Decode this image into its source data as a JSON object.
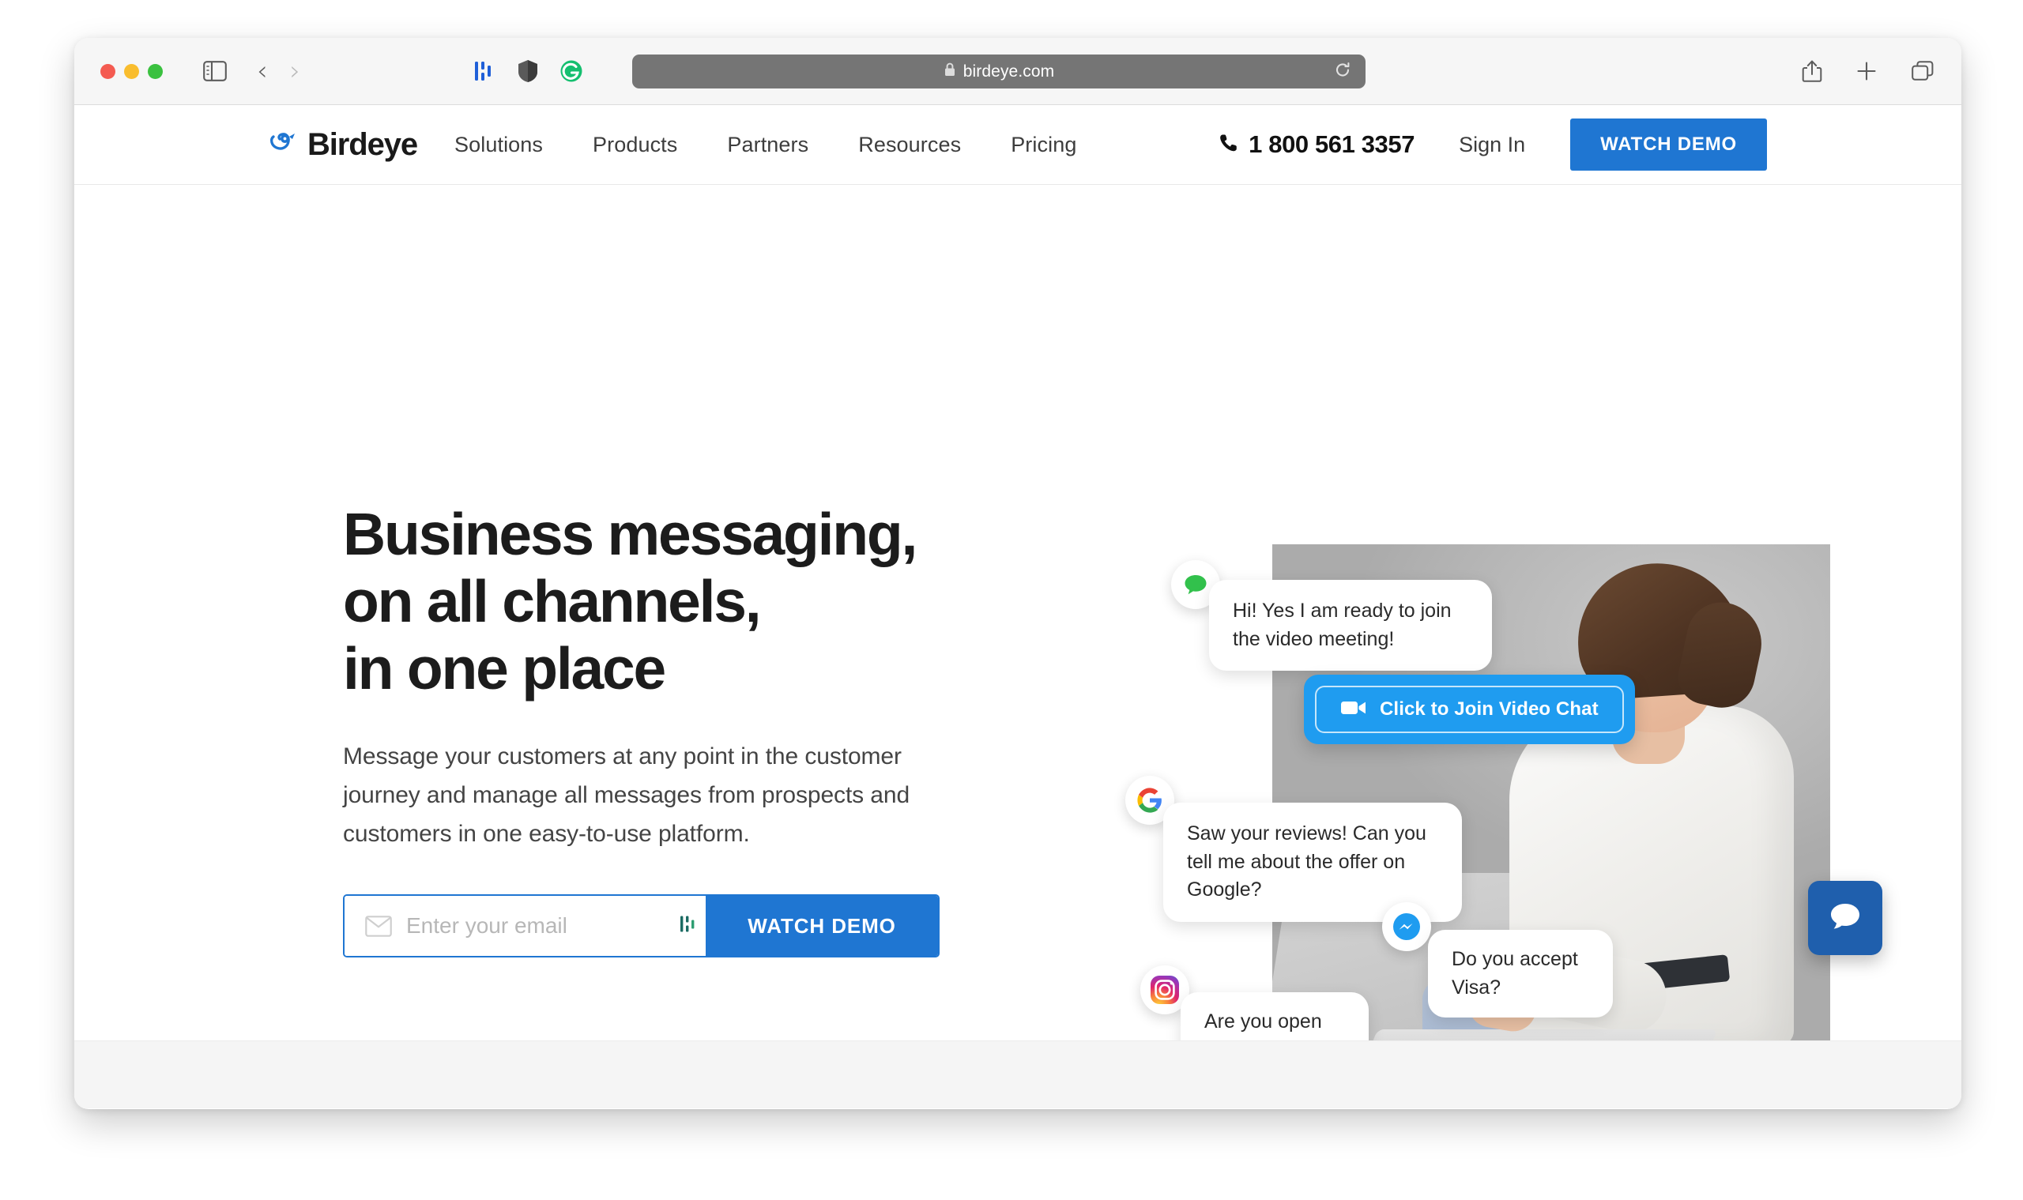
{
  "browser": {
    "url": "birdeye.com",
    "lock_icon": "lock-icon",
    "sidebar_icon": "sidebar-toggle-icon",
    "back_icon": "back-arrow-icon",
    "forward_icon": "forward-arrow-icon",
    "extensions": [
      "onepassword-icon",
      "shield-privacy-icon",
      "grammarly-icon"
    ],
    "reload_icon": "reload-icon",
    "share_icon": "share-icon",
    "new_tab_icon": "plus-icon",
    "tab_overview_icon": "tab-overview-icon"
  },
  "nav": {
    "brand": "Birdeye",
    "links": [
      "Solutions",
      "Products",
      "Partners",
      "Resources",
      "Pricing"
    ],
    "phone": "1 800 561 3357",
    "phone_icon": "phone-icon",
    "signin": "Sign In",
    "cta": "WATCH DEMO"
  },
  "hero": {
    "headline_lines": [
      "Business messaging,",
      "on all channels,",
      "in one place"
    ],
    "subhead": "Message your customers at any point in the customer journey and manage all messages from prospects and customers in one easy-to-use platform.",
    "email_placeholder": "Enter your email",
    "email_value": "",
    "email_icon": "envelope-icon",
    "password_manager_icon": "password-manager-icon",
    "cta": "WATCH DEMO"
  },
  "bubbles": [
    {
      "id": "sms",
      "avatar": "sms-message-icon",
      "text": "Hi! Yes I am ready to join the video meeting!"
    },
    {
      "id": "google",
      "avatar": "google-icon",
      "text": "Saw your reviews! Can you tell me about the offer on Google?"
    },
    {
      "id": "messenger",
      "avatar": "facebook-messenger-icon",
      "text": "Do you accept Visa?"
    },
    {
      "id": "instagram",
      "avatar": "instagram-icon",
      "text": "Are you open today?"
    }
  ],
  "video_cta": {
    "label": "Click to Join Video Chat",
    "icon": "video-camera-icon"
  },
  "chat_widget": {
    "icon": "chat-bubble-icon"
  },
  "colors": {
    "brand_blue": "#1f76d2",
    "bubble_blue": "#1f9cf0",
    "widget_blue": "#1f5fad",
    "headline": "#1c1c1c"
  }
}
